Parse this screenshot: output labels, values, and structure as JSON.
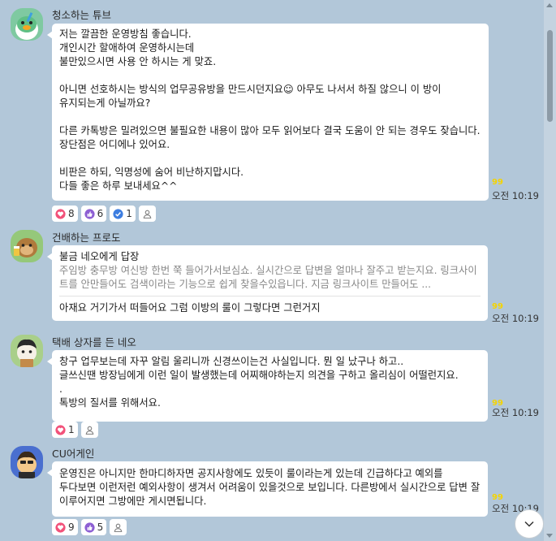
{
  "messages": [
    {
      "sender": "청소하는 튜브",
      "text": "저는 깔끔한 운영방침 좋습니다.\n개인시간 할애하여 운영하시는데\n불만있으시면 사용 안 하시는 게 맞죠.\n\n아니면 선호하시는 방식의 업무공유방을 만드시던지요☺ 아무도 나서서 하질 않으니 이 방이 유지되는게 아닐까요?\n\n다른 카톡방은 밀려있으면 불필요한 내용이 많아 모두 읽어보다 결국 도움이 안 되는 경우도 잦습니다. 장단점은 어디에나 있어요.\n\n비판은 하되, 익명성에 숨어 비난하지맙시다.\n다들 좋은 하루 보내세요^^",
      "unread": "99",
      "time": "오전 10:19",
      "reactions": [
        {
          "icon": "heart-icon",
          "count": "8",
          "color": "#f2527a"
        },
        {
          "icon": "thumbs-up-icon",
          "count": "6",
          "color": "#8d5fd3"
        },
        {
          "icon": "check-icon",
          "count": "1",
          "color": "#3d7de0"
        },
        {
          "icon": "person-icon",
          "count": "",
          "color": "#7a7a7a"
        }
      ]
    },
    {
      "sender": "건배하는 프로도",
      "reply_label": "불금 네오에게 답장",
      "quote": "주임방 충무방 여신방 한번 쭉 들어가서보심쇼. 실시간으로 답변을 얼마나 잘주고 받는지요. 링크사이트를 안만들어도 검색이라는 기능으로 쉽게 찾을수있읍니다. 지금 링크사이트 만들어도 ...",
      "text": "아재요 거기가서 떠들어요 그럼 이방의 룰이 그렇다면 그런거지",
      "unread": "99",
      "time": "오전 10:19"
    },
    {
      "sender": "택배 상자를 든 네오",
      "text": "창구 업무보는데 자꾸 알림 울리니까 신경쓰이는건 사실입니다. 뭔 일 났구나 하고..\n글쓰신땐 방장님에게 이런 일이 발생했는데 어찌해야하는지 의견을 구하고 올리심이 어떨런지요.\n.\n톡방의 질서를 위해서요.",
      "unread": "99",
      "time": "오전 10:19",
      "reactions": [
        {
          "icon": "heart-icon",
          "count": "1",
          "color": "#f2527a"
        },
        {
          "icon": "person-icon",
          "count": "",
          "color": "#7a7a7a"
        }
      ]
    },
    {
      "sender": "CU어게인",
      "text": "운영진은 아니지만 한마디하자면 공지사항에도 있듯이 룰이라는게 있는데 긴급하다고 예외를 두다보면 이런저런 예외사항이 생겨서 어려움이 있을것으로 보입니다. 다른방에서 실시간으로 답변 잘 이루어지면 그방에만 게시면됩니다.",
      "unread": "99",
      "time": "오전 10:19",
      "reactions": [
        {
          "icon": "heart-icon",
          "count": "9",
          "color": "#f2527a"
        },
        {
          "icon": "thumbs-up-icon",
          "count": "5",
          "color": "#8d5fd3"
        },
        {
          "icon": "person-icon",
          "count": "",
          "color": "#7a7a7a"
        }
      ]
    }
  ],
  "theme": {
    "background": "#b2c7d9",
    "bubble": "#ffffff",
    "unread": "#f5d400"
  },
  "controls": {
    "jump_icon": "chevron-down-icon"
  }
}
